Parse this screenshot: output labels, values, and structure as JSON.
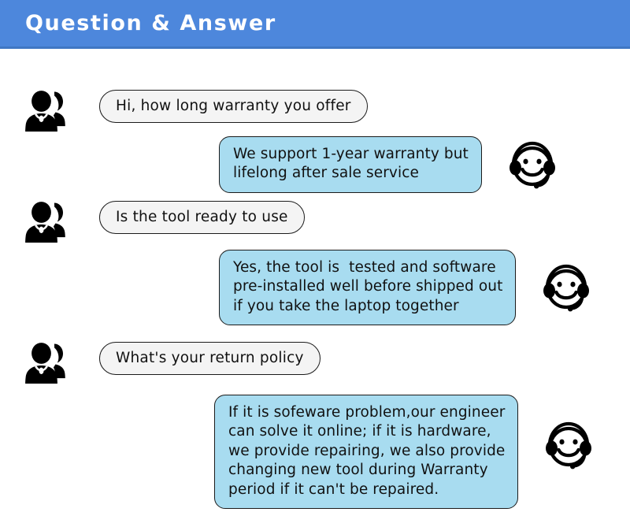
{
  "header": {
    "title": "Question & Answer",
    "background_color": "#4d87dc",
    "text_color": "#ffffff"
  },
  "theme": {
    "page_background": "#ffffff",
    "question_bubble_color": "#f4f4f4",
    "answer_bubble_color": "#a8dcf0",
    "bubble_border_color": "#1b1b1b",
    "icon_color": "#000000"
  },
  "icons": {
    "user": "user-group-icon",
    "agent": "headset-smiley-icon"
  },
  "conversation": [
    {
      "role": "question",
      "avatar": "user-group-icon",
      "text": "Hi, how long warranty you offer"
    },
    {
      "role": "answer",
      "avatar": "headset-smiley-icon",
      "text": "We support 1-year warranty but\nlifelong after sale service"
    },
    {
      "role": "question",
      "avatar": "user-group-icon",
      "text": "Is the tool ready to use"
    },
    {
      "role": "answer",
      "avatar": "headset-smiley-icon",
      "text": "Yes, the tool is  tested and software\npre-installed well before shipped out\nif you take the laptop together"
    },
    {
      "role": "question",
      "avatar": "user-group-icon",
      "text": "What's your return policy"
    },
    {
      "role": "answer",
      "avatar": "headset-smiley-icon",
      "text": "If it is sofeware problem,our engineer\ncan solve it online; if it is hardware,\nwe provide repairing, we also provide\nchanging new tool during Warranty\nperiod if it can't be repaired."
    }
  ]
}
